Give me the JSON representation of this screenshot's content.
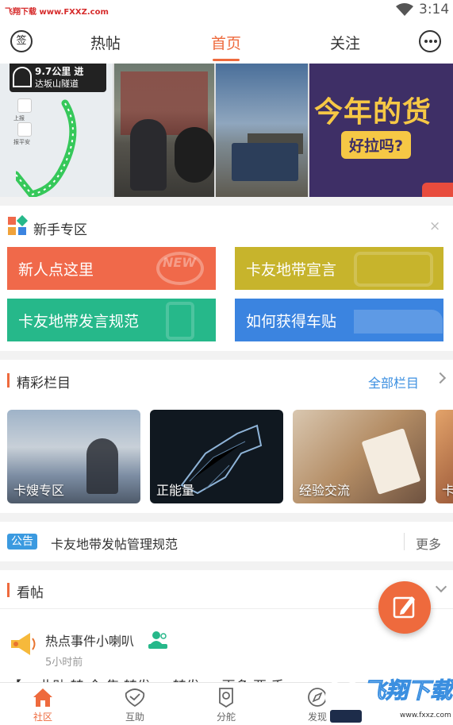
{
  "status": {
    "watermark": "飞翔下载 www.FXXZ.com",
    "time": "3:14"
  },
  "topnav": {
    "sign_label": "签",
    "tabs": [
      {
        "label": "热帖"
      },
      {
        "label": "首页"
      },
      {
        "label": "关注"
      }
    ],
    "active_tab": "首页"
  },
  "banner": {
    "slide1_distance": "9.7公里 进",
    "slide1_road": "达坂山隧道",
    "slide1_btn1": "上报",
    "slide1_btn2": "报平安",
    "slide4_headline": "今年的货",
    "slide4_sub": "好拉吗?",
    "slide_count": 5,
    "active_slide": 2
  },
  "newbie": {
    "title": "新手专区",
    "close": "×",
    "cards": [
      {
        "label": "新人点这里",
        "deco": "NEW",
        "color": "#f0694a"
      },
      {
        "label": "卡友地带宣言",
        "color": "#c7b42c"
      },
      {
        "label": "卡友地带发言规范",
        "color": "#26b88a"
      },
      {
        "label": "如何获得车贴",
        "color": "#3b84e0"
      }
    ]
  },
  "columns": {
    "title": "精彩栏目",
    "all_label": "全部栏目",
    "items": [
      {
        "label": "卡嫂专区"
      },
      {
        "label": "正能量"
      },
      {
        "label": "经验交流"
      },
      {
        "label": "卡"
      }
    ]
  },
  "notice": {
    "badge": "公告",
    "text": "卡友地带发帖管理规范",
    "more": "更多"
  },
  "posts": {
    "title": "看帖",
    "author": "热点事件小喇叭",
    "badge": "管理员",
    "time": "5小时前",
    "snippet": "【… 此贴 转 全 集 转发 … 转发 … 更多 要 手"
  },
  "tabbar": {
    "items": [
      {
        "label": "社区"
      },
      {
        "label": "互助"
      },
      {
        "label": "分舵"
      },
      {
        "label": "发现"
      }
    ],
    "active": "社区"
  },
  "watermark_br": {
    "title": "飞翔下载",
    "url": "www.fxxz.com"
  },
  "colors": {
    "accent": "#ee6a3d",
    "link": "#3b8fe0"
  }
}
